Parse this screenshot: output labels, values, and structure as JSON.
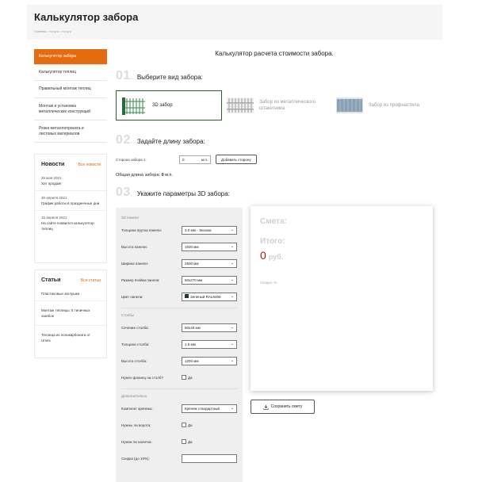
{
  "header": {
    "title": "Калькулятор забора",
    "breadcrumbs": "Главная • Услуги • Услуги"
  },
  "sidebar": {
    "menu": [
      {
        "label": "Калькулятор забора",
        "active": true
      },
      {
        "label": "Калькулятор теплиц"
      },
      {
        "label": "Правильный монтаж теплиц"
      },
      {
        "label": "Монтаж и установка металлических конструкций"
      },
      {
        "label": "Резка металлопроката и листовых материалов"
      }
    ],
    "news": {
      "title": "Новости",
      "all_link": "Все новости",
      "items": [
        {
          "date": "26 мая 2021",
          "text": "Хит продаж!"
        },
        {
          "date": "30 апреля 2021",
          "text": "График работы в праздничные дни"
        },
        {
          "date": "15 апреля 2021",
          "text": "На сайте появился калькулятор теплиц"
        }
      ]
    },
    "articles": {
      "title": "Статьи",
      "all_link": "Все статьи",
      "items": [
        {
          "text": "Пластиковые заглушки"
        },
        {
          "text": "Монтаж теплицы: 5 типичных ошибок"
        },
        {
          "text": "Теплица из поликарбоната от Umex"
        }
      ]
    }
  },
  "main": {
    "title": "Калькулятор расчета стоимости забора.",
    "step1": {
      "num": "01",
      "label": "Выберите вид забора:"
    },
    "fence_types": [
      {
        "label": "3D забор",
        "selected": true
      },
      {
        "label": "Забор из металлического штакетника"
      },
      {
        "label": "Забор из профнастила"
      }
    ],
    "step2": {
      "num": "02",
      "label": "Задайте длину забора:"
    },
    "length": {
      "side_label": "Сторона забора 1:",
      "value": "0",
      "unit": "м.п.",
      "add_button": "Добавить сторону"
    },
    "total_length": {
      "label": "Общая длина забора:",
      "value": "0",
      "unit": "м.п."
    },
    "step3": {
      "num": "03",
      "label": "Укажите параметры 3D забора:"
    },
    "params": {
      "panel_section": "3D панели",
      "rod_thickness": {
        "label": "Толщина прутка панели:",
        "value": "3.0 мм - Эконом"
      },
      "panel_height": {
        "label": "Высота панели:",
        "value": "1530 мм"
      },
      "panel_width": {
        "label": "Ширина панели:",
        "value": "2500 мм"
      },
      "cell_size": {
        "label": "Размер ячейки панели:",
        "value": "50x270 мм"
      },
      "panel_color": {
        "label": "Цвет панели:",
        "value": "Зеленый RAL6005",
        "swatch": "#1d3b2a"
      },
      "posts_section": "Столбы",
      "post_section": {
        "label": "Сечение столба:",
        "value": "60x40 мм"
      },
      "post_thickness": {
        "label": "Толщина столба:",
        "value": "1.5 мм"
      },
      "post_height": {
        "label": "Высота столба:",
        "value": "1200 мм"
      },
      "flange": {
        "label": "Нужен фланец на столб?",
        "option": "Да"
      },
      "extra_section": "Дополнительно",
      "fasteners": {
        "label": "Комплект крепежа:",
        "value": "Крепеж стандартный"
      },
      "gate": {
        "label": "Нужны ли ворота:",
        "option": "Да"
      },
      "wicket": {
        "label": "Нужна ли калитка:",
        "option": "Да"
      },
      "discount": {
        "label": "Скидка (до 10%):",
        "value": ""
      }
    },
    "estimate": {
      "title": "Смета:",
      "total_label": "Итого:",
      "total_value": "0",
      "currency": "руб.",
      "discount_label": "Скидка: %"
    },
    "save_button": "Сохранить смету"
  },
  "colors": {
    "accent": "#e56a10",
    "selected_border": "#2c5e2e",
    "total_value": "#9c1a1a",
    "params_bg": "#efefef"
  }
}
